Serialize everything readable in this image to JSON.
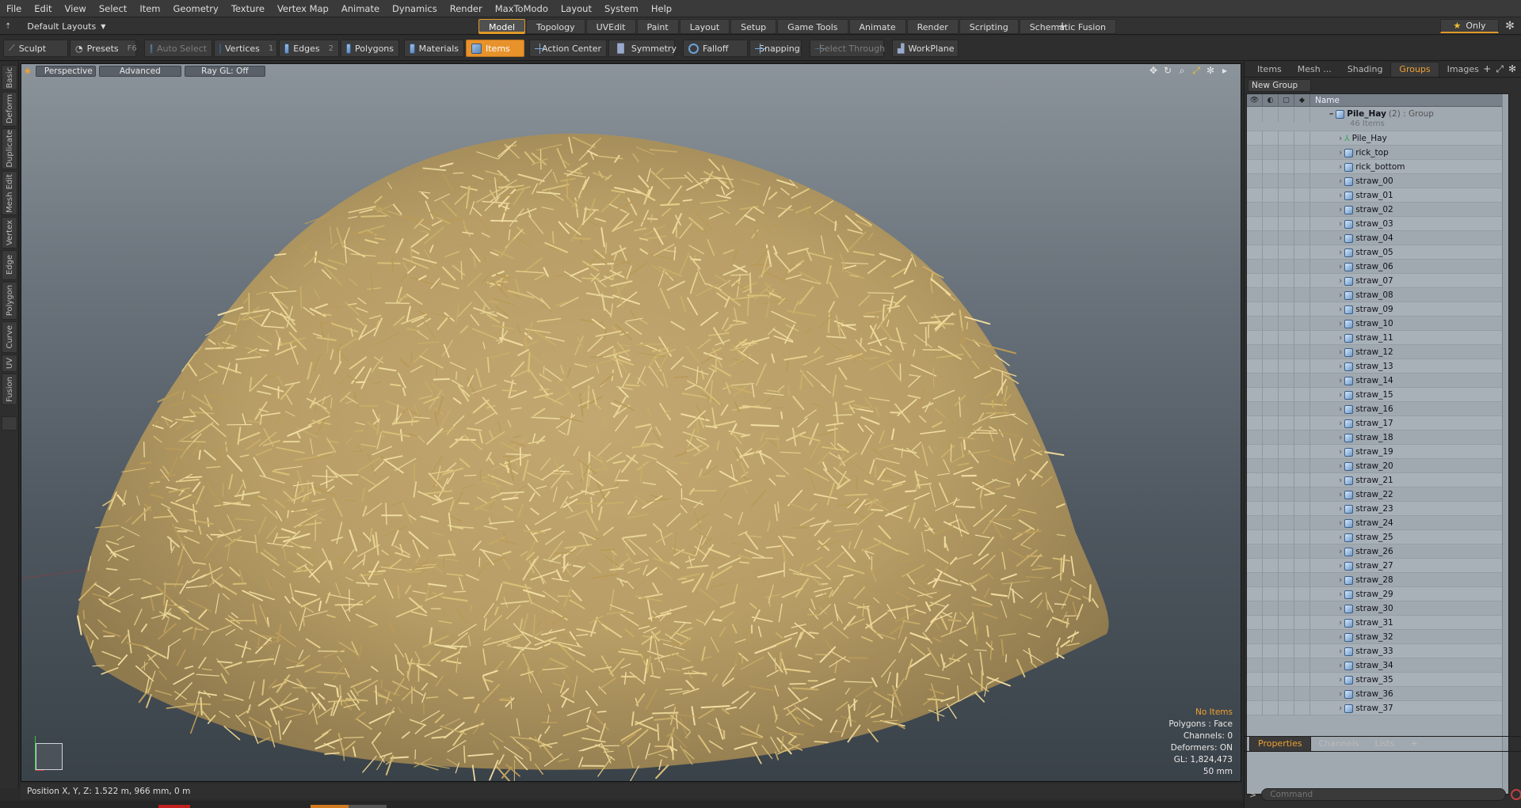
{
  "menubar": [
    "File",
    "Edit",
    "View",
    "Select",
    "Item",
    "Geometry",
    "Texture",
    "Vertex Map",
    "Animate",
    "Dynamics",
    "Render",
    "MaxToModo",
    "Layout",
    "System",
    "Help"
  ],
  "layout": {
    "selector": "Default Layouts",
    "tabs": [
      "Model",
      "Topology",
      "UVEdit",
      "Paint",
      "Layout",
      "Setup",
      "Game Tools",
      "Animate",
      "Render",
      "Scripting",
      "Schematic Fusion"
    ],
    "active_tab": "Model",
    "only_label": "Only"
  },
  "toolbar": {
    "sculpt": "Sculpt",
    "presets": "Presets",
    "presets_key": "F6",
    "auto_select": "Auto Select",
    "vertices": "Vertices",
    "vertices_key": "1",
    "edges": "Edges",
    "edges_key": "2",
    "polygons": "Polygons",
    "materials": "Materials",
    "items": "Items",
    "action_center": "Action Center",
    "symmetry": "Symmetry",
    "falloff": "Falloff",
    "snapping": "Snapping",
    "select_through": "Select Through",
    "workplane": "WorkPlane"
  },
  "left_tabs": [
    "Basic",
    "Deform",
    "Duplicate",
    "Mesh Edit",
    "Vertex",
    "Edge",
    "Polygon",
    "Curve",
    "UV",
    "Fusion"
  ],
  "viewport": {
    "view": "Perspective",
    "shading": "Advanced",
    "raygl": "Ray GL: Off",
    "info": {
      "selection": "No Items",
      "polygons": "Polygons : Face",
      "channels": "Channels: 0",
      "deformers": "Deformers: ON",
      "gl": "GL: 1,824,473",
      "scale": "50 mm"
    }
  },
  "status": {
    "position": "Position X, Y, Z:   1.522 m, 966 mm, 0 m"
  },
  "panel": {
    "tabs": [
      "Items",
      "Mesh ...",
      "Shading",
      "Groups",
      "Images"
    ],
    "active_tab": "Groups",
    "new_group": "New Group",
    "name_header": "Name",
    "group": {
      "name": "Pile_Hay",
      "meta": "(2) : Group",
      "count": "46 Items"
    },
    "items": [
      "Pile_Hay",
      "rick_top",
      "rick_bottom",
      "straw_00",
      "straw_01",
      "straw_02",
      "straw_03",
      "straw_04",
      "straw_05",
      "straw_06",
      "straw_07",
      "straw_08",
      "straw_09",
      "straw_10",
      "straw_11",
      "straw_12",
      "straw_13",
      "straw_14",
      "straw_15",
      "straw_16",
      "straw_17",
      "straw_18",
      "straw_19",
      "straw_20",
      "straw_21",
      "straw_22",
      "straw_23",
      "straw_24",
      "straw_25",
      "straw_26",
      "straw_27",
      "straw_28",
      "straw_29",
      "straw_30",
      "straw_31",
      "straw_32",
      "straw_33",
      "straw_34",
      "straw_35",
      "straw_36",
      "straw_37"
    ],
    "bottom_tabs": [
      "Properties",
      "Channels",
      "Lists"
    ],
    "bottom_active": "Properties",
    "command_placeholder": "Command"
  },
  "colors": {
    "accent": "#e8922c",
    "hay": "#d9c07e"
  }
}
